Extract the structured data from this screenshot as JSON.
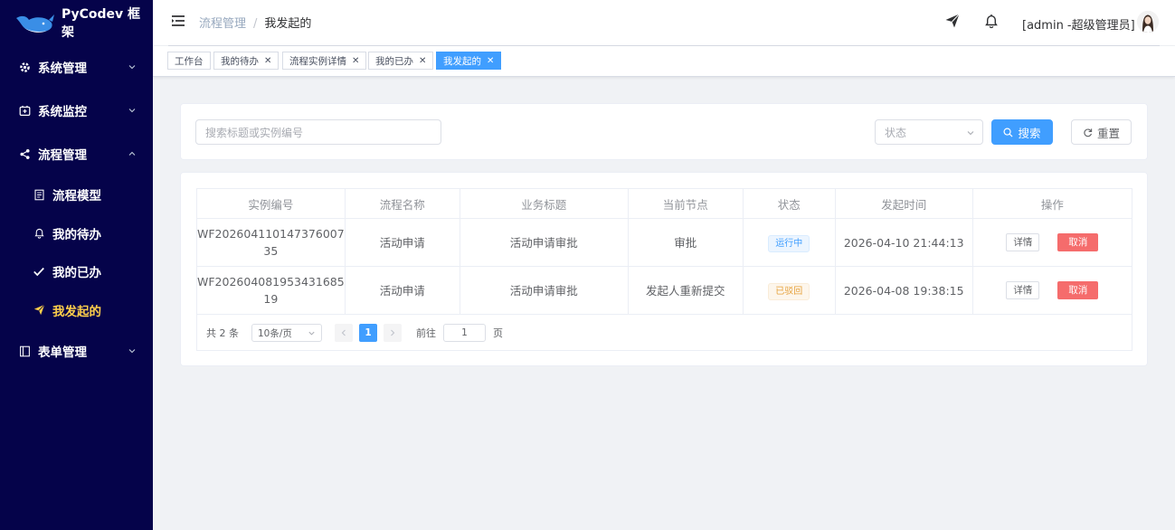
{
  "app": {
    "logo_text": "PyCodev 框架"
  },
  "sidebar": {
    "items": [
      {
        "label": "系统管理"
      },
      {
        "label": "系统监控"
      },
      {
        "label": "流程管理"
      },
      {
        "label": "表单管理"
      }
    ],
    "sub_items": [
      {
        "label": "流程模型"
      },
      {
        "label": "我的待办"
      },
      {
        "label": "我的已办"
      },
      {
        "label": "我发起的"
      }
    ]
  },
  "header": {
    "breadcrumb": [
      "流程管理",
      "我发起的"
    ],
    "user": "[admin -超级管理员]"
  },
  "tags": [
    {
      "label": "工作台",
      "closable": false
    },
    {
      "label": "我的待办",
      "closable": true
    },
    {
      "label": "流程实例详情",
      "closable": true
    },
    {
      "label": "我的已办",
      "closable": true
    },
    {
      "label": "我发起的",
      "closable": true,
      "active": true
    }
  ],
  "search": {
    "keyword_placeholder": "搜索标题或实例编号",
    "status_placeholder": "状态",
    "search_label": "搜索",
    "reset_label": "重置"
  },
  "table": {
    "columns": [
      "实例编号",
      "流程名称",
      "业务标题",
      "当前节点",
      "状态",
      "发起时间",
      "操作"
    ],
    "rows": [
      {
        "id_line1": "WF202604110147376007",
        "id_line2": "35",
        "name": "活动申请",
        "title": "活动申请审批",
        "node": "审批",
        "status": "运行中",
        "time": "2026-04-10 21:44:13",
        "detail": "详情",
        "cancel": "取消"
      },
      {
        "id_line1": "WF202604081953431685",
        "id_line2": "19",
        "name": "活动申请",
        "title": "活动申请审批",
        "node": "发起人重新提交",
        "status": "已驳回",
        "time": "2026-04-08 19:38:15",
        "detail": "详情",
        "cancel": "取消"
      }
    ]
  },
  "pagination": {
    "total_text": "共 2 条",
    "page_size": "10条/页",
    "current_page": "1",
    "goto_label": "前往",
    "goto_value": "1",
    "page_unit": "页"
  },
  "colors": {
    "sidebar_bg": "#05034a",
    "accent": "#409eff",
    "active_menu": "#ffd04b",
    "danger": "#f56c6c",
    "warning": "#e6a23c"
  }
}
